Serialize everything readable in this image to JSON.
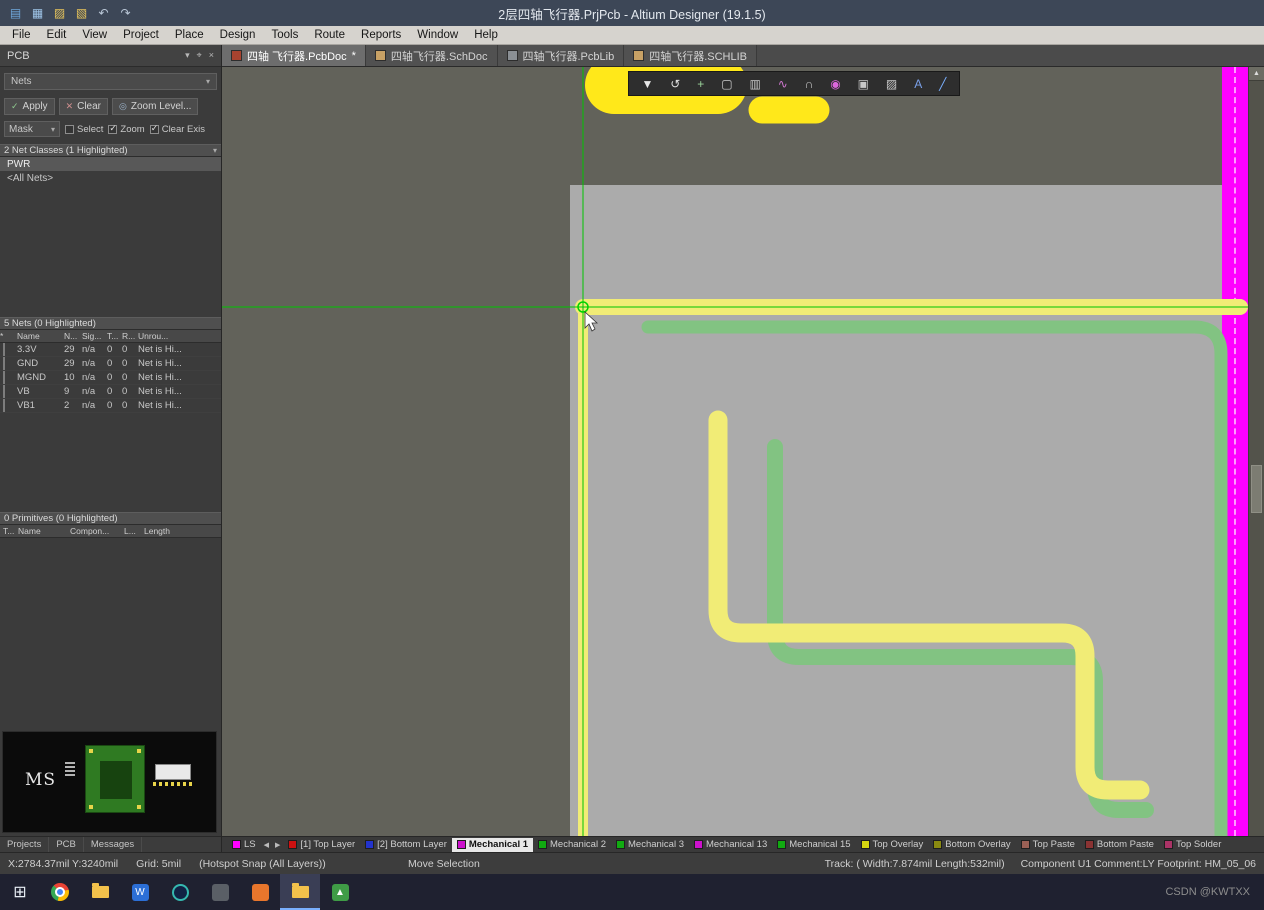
{
  "titlebar": {
    "title": "2层四轴飞行器.PrjPcb - Altium Designer (19.1.5)",
    "icons": [
      {
        "name": "new-document-icon",
        "glyph": "▤"
      },
      {
        "name": "open-project-icon",
        "glyph": "▦"
      },
      {
        "name": "open-folder-icon",
        "glyph": "▨"
      },
      {
        "name": "save-icon",
        "glyph": "▧"
      },
      {
        "name": "undo-icon",
        "glyph": "↶"
      },
      {
        "name": "redo-icon",
        "glyph": "↷"
      }
    ]
  },
  "menubar": {
    "items": [
      "File",
      "Edit",
      "View",
      "Project",
      "Place",
      "Design",
      "Tools",
      "Route",
      "Reports",
      "Window",
      "Help"
    ]
  },
  "doc_tabs": [
    {
      "label": "四轴 飞行器.PcbDoc",
      "modified": "*",
      "icon_color": "#a8432f"
    },
    {
      "label": "四轴飞行器.SchDoc",
      "modified": "",
      "icon_color": "#c8a165"
    },
    {
      "label": "四轴飞行器.PcbLib",
      "modified": "",
      "icon_color": "#8a8f94"
    },
    {
      "label": "四轴飞行器.SCHLIB",
      "modified": "",
      "icon_color": "#c8a165"
    }
  ],
  "pcb_panel": {
    "title": "PCB",
    "header_icons": {
      "dropdown": "▾",
      "pin": "⌖",
      "close": "×"
    },
    "nets_dropdown": {
      "value": "Nets",
      "arrow": "▾"
    },
    "buttons": {
      "apply": {
        "icon": "✓",
        "label": "Apply"
      },
      "clear": {
        "icon": "✕",
        "label": "Clear"
      },
      "zoom_level": {
        "icon": "◎",
        "label": "Zoom Level..."
      }
    },
    "mask_dropdown": {
      "value": "Mask",
      "arrow": "▾"
    },
    "checkboxes": {
      "select": "Select",
      "zoom": "Zoom",
      "clear_existing": "Clear Exis"
    },
    "net_classes": {
      "header": "2 Net Classes (1 Highlighted)",
      "items": [
        {
          "label": "PWR",
          "selected": true
        },
        {
          "label": "<All Nets>",
          "selected": false
        }
      ]
    },
    "nets": {
      "header": "5 Nets (0 Highlighted)",
      "columns": {
        "swatch": "",
        "name": "Name",
        "nodes": "N...",
        "signal": "Sig...",
        "t": "T...",
        "r": "R...",
        "unrouted": "Unrou..."
      },
      "rows": [
        {
          "name": "3.3V",
          "nodes": "29",
          "signal": "n/a",
          "t": "0",
          "r": "0",
          "unrouted": "Net is Hi..."
        },
        {
          "name": "GND",
          "nodes": "29",
          "signal": "n/a",
          "t": "0",
          "r": "0",
          "unrouted": "Net is Hi..."
        },
        {
          "name": "MGND",
          "nodes": "10",
          "signal": "n/a",
          "t": "0",
          "r": "0",
          "unrouted": "Net is Hi..."
        },
        {
          "name": "VB",
          "nodes": "9",
          "signal": "n/a",
          "t": "0",
          "r": "0",
          "unrouted": "Net is Hi..."
        },
        {
          "name": "VB1",
          "nodes": "2",
          "signal": "n/a",
          "t": "0",
          "r": "0",
          "unrouted": "Net is Hi..."
        }
      ]
    },
    "primitives": {
      "header": "0 Primitives (0 Highlighted)",
      "columns": {
        "t": "T...",
        "name": "Name",
        "component": "Compon...",
        "l": "L...",
        "length": "Length"
      }
    },
    "preview": {
      "ms_label": "MS"
    }
  },
  "panel_tabs": [
    "Projects",
    "PCB",
    "Messages"
  ],
  "canvas": {
    "toolbar": [
      {
        "name": "filter-icon",
        "glyph": "▼",
        "color": "#e8e8e8"
      },
      {
        "name": "lasso-select-icon",
        "glyph": "↺",
        "color": "#e0e0e0"
      },
      {
        "name": "move-icon",
        "glyph": "+",
        "color": "#9ad29a"
      },
      {
        "name": "selection-rect-icon",
        "glyph": "▢",
        "color": "#cccccc"
      },
      {
        "name": "histogram-icon",
        "glyph": "▥",
        "color": "#c8c8c8"
      },
      {
        "name": "interactive-route-icon",
        "glyph": "∿",
        "color": "#d078d0"
      },
      {
        "name": "arc-icon",
        "glyph": "∩",
        "color": "#c8c8c8"
      },
      {
        "name": "via-icon",
        "glyph": "◉",
        "color": "#dd66dd"
      },
      {
        "name": "pad-icon",
        "glyph": "▣",
        "color": "#c8c8c8"
      },
      {
        "name": "region-icon",
        "glyph": "▨",
        "color": "#c8c8c8"
      },
      {
        "name": "text-icon",
        "glyph": "A",
        "color": "#7aa0e8"
      },
      {
        "name": "line-icon",
        "glyph": "╱",
        "color": "#7ab0ff"
      }
    ],
    "scroll_up_arrow": "▲"
  },
  "colors": {
    "top_layer_trace_yellow": "#f1ec76",
    "bottom_layer_trace_green": "#82c382",
    "overlay_yellow": "#ffe81a",
    "keepout_magenta": "#ff00ff",
    "crosshair_green": "#00c400",
    "board_gray": "#ababab",
    "canvas_background": "#62625a"
  },
  "layers_bar": {
    "ls_label": "LS",
    "ls_color": "#ff00ff",
    "nav_prev": "◀",
    "nav_next": "▶",
    "layers": [
      {
        "label": "[1] Top Layer",
        "color": "#cc1111",
        "active": false
      },
      {
        "label": "[2] Bottom Layer",
        "color": "#2233cc",
        "active": false
      },
      {
        "label": "Mechanical 1",
        "color": "#cc11cc",
        "active": true
      },
      {
        "label": "Mechanical 2",
        "color": "#11aa11",
        "active": false
      },
      {
        "label": "Mechanical 3",
        "color": "#11aa11",
        "active": false
      },
      {
        "label": "Mechanical 13",
        "color": "#cc11cc",
        "active": false
      },
      {
        "label": "Mechanical 15",
        "color": "#11aa11",
        "active": false
      },
      {
        "label": "Top Overlay",
        "color": "#d6d611",
        "active": false
      },
      {
        "label": "Bottom Overlay",
        "color": "#8a8a11",
        "active": false
      },
      {
        "label": "Top Paste",
        "color": "#9a6055",
        "active": false
      },
      {
        "label": "Bottom Paste",
        "color": "#8a3333",
        "active": false
      },
      {
        "label": "Top Solder",
        "color": "#aa3366",
        "active": false
      }
    ]
  },
  "status_bar": {
    "coordinates": "X:2784.37mil Y:3240mil",
    "grid": "Grid: 5mil",
    "snap": "(Hotspot Snap (All Layers))",
    "action": "Move Selection",
    "track_info": "Track: ( Width:7.874mil Length:532mil)",
    "component_info": "Component U1 Comment:LY Footprint: HM_05_06"
  },
  "taskbar": {
    "watermark": "CSDN @KWTXX"
  }
}
